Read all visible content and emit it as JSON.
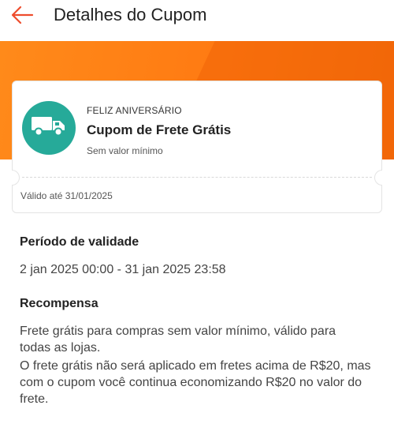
{
  "header": {
    "title": "Detalhes do Cupom",
    "back_icon": "arrow-left-icon",
    "accent_color": "#ee4d2d"
  },
  "banner": {
    "color": "#ff7a12"
  },
  "coupon": {
    "icon": "truck-icon",
    "icon_bg_color": "#26aa99",
    "tag": "FELIZ ANIVERSÁRIO",
    "title": "Cupom de Frete Grátis",
    "min_value": "Sem valor mínimo",
    "valid_until": "Válido até 31/01/2025"
  },
  "validity": {
    "title": "Período de validade",
    "range": "2 jan 2025 00:00 - 31 jan 2025 23:58"
  },
  "reward": {
    "title": "Recompensa",
    "text_1": "Frete grátis para compras sem valor mínimo, válido para todas as lojas.",
    "text_2": "O frete grátis não será aplicado em fretes acima de R$20, mas com o cupom você continua economizando R$20 no valor do frete."
  }
}
